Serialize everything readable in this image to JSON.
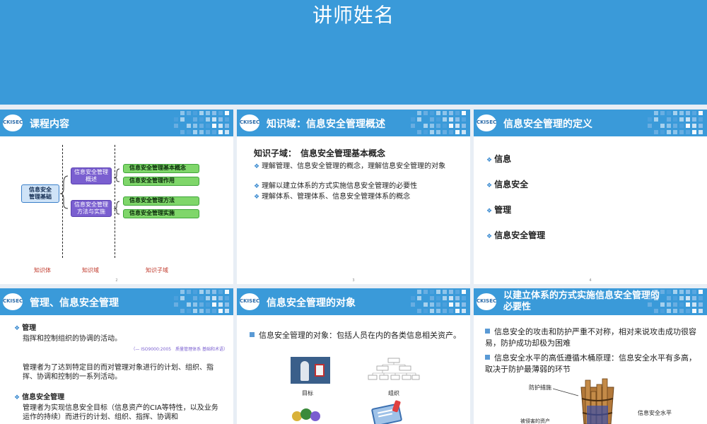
{
  "banner": {
    "title": "讲师姓名"
  },
  "logo_text": "CKISEC",
  "slides": {
    "s1": {
      "title": "课程内容",
      "node_root": "信息安全\n管理基础",
      "node_a": "信息安全管理\n概述",
      "node_b": "信息安全管理\n方法与实施",
      "leaf_1": "信息安全管理基本概念",
      "leaf_2": "信息安全管理作用",
      "leaf_3": "信息安全管理方法",
      "leaf_4": "信息安全管理实施",
      "col_1": "知识体",
      "col_2": "知识域",
      "col_3": "知识子域",
      "page": "2"
    },
    "s2": {
      "title": "知识域：信息安全管理概述",
      "heading": "知识子域：　信息安全管理基本概念",
      "bullets": [
        "理解管理、信息安全管理的概念，理解信息安全管理的对象",
        "理解以建立体系的方式实施信息安全管理的必要性",
        "理解体系、管理体系、信息安全管理体系的概念"
      ],
      "page": "3"
    },
    "s3": {
      "title": "信息安全管理的定义",
      "items": [
        "信息",
        "信息安全",
        "管理",
        "信息安全管理"
      ],
      "page": "4"
    },
    "s4": {
      "title": "管理、信息安全管理",
      "h1": "管理",
      "p1": "指挥和控制组织的协调的活动。",
      "ref": "（— ISO9000:2005　质量管理体系 基础和术语）",
      "p2": "管理者为了达到特定目的而对管理对象进行的计划、组织、指挥、协调和控制的一系列活动。",
      "h2": "信息安全管理",
      "p3": "管理者为实现信息安全目标（信息资产的CIA等特性，以及业务运作的持续）而进行的计划、组织、指挥、协调和"
    },
    "s5": {
      "title": "信息安全管理的对象",
      "bullet": "信息安全管理的对象：包括人员在内的各类信息相关资产。",
      "cap_1": "目标",
      "cap_2": "组织"
    },
    "s6": {
      "title": "以建立体系的方式实施信息安全管理的必要性",
      "b1": "信息安全的攻击和防护严重不对称，相对来说攻击成功很容易，防护成功却极为困难",
      "b2": "信息安全水平的高低遵循木桶原理：信息安全水平有多高，取决于防护最薄弱的环节",
      "lbl_1": "防护措施",
      "lbl_2": "信息安全水平",
      "lbl_3": "被侵害的资产"
    }
  },
  "colors": {
    "header_blue": "#3a9ad9",
    "accent_blue": "#3a8ad0",
    "leaf_green": "#7fd66a",
    "node_purple": "#7a5fd0",
    "label_red": "#c0392b"
  }
}
